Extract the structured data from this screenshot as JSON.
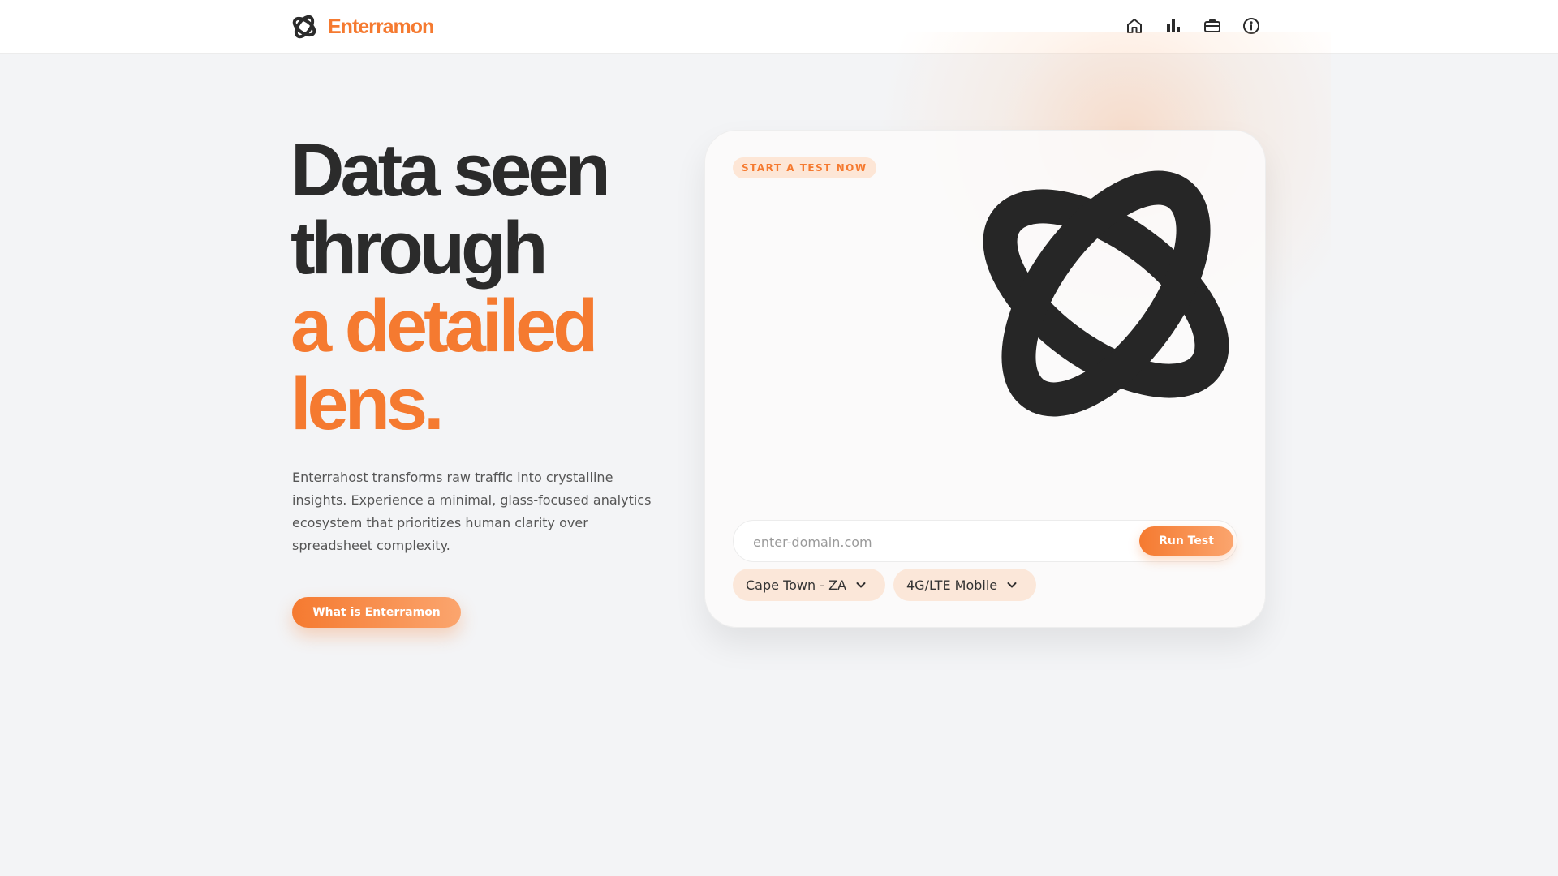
{
  "brand": {
    "name": "Enterramon",
    "accent_color": "#f57a30",
    "text_color": "#2b2b2b"
  },
  "nav": [
    {
      "icon": "home-icon"
    },
    {
      "icon": "bar-chart-icon"
    },
    {
      "icon": "briefcase-icon"
    },
    {
      "icon": "info-icon"
    }
  ],
  "hero": {
    "title_line1": "Data seen",
    "title_line2": "through",
    "title_line3": "a detailed",
    "title_line4": "lens.",
    "description": "Enterrahost transforms raw traffic into crystalline insights. Experience a minimal, glass-focused analytics ecosystem that prioritizes human clarity over spreadsheet complexity.",
    "cta_label": "What is Enterramon"
  },
  "test_card": {
    "pill_label": "START A TEST NOW",
    "art_icon": "enterramon-logo-mark",
    "domain_placeholder": "enter-domain.com",
    "domain_value": "",
    "run_label": "Run Test",
    "location_selected": "Cape Town - ZA",
    "network_selected": "4G/LTE Mobile"
  }
}
